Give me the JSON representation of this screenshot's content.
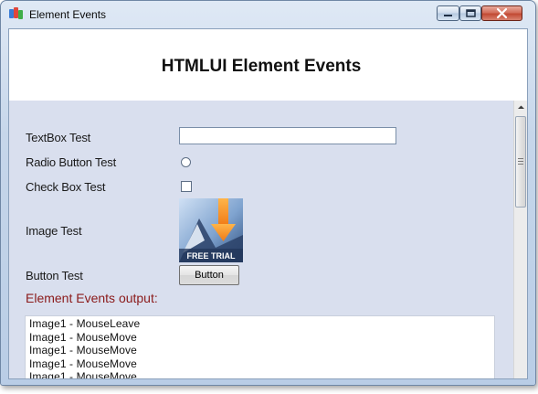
{
  "window": {
    "title": "Element Events",
    "accent": "#c24a34"
  },
  "page": {
    "title": "HTMLUI Element Events"
  },
  "form": {
    "textbox_label": "TextBox Test",
    "textbox_value": "",
    "radio_label": "Radio Button Test",
    "radio_checked": false,
    "checkbox_label": "Check Box Test",
    "checkbox_checked": false,
    "image_label": "Image Test",
    "image_caption": "FREE TRIAL",
    "button_label": "Button Test",
    "button_text": "Button"
  },
  "output": {
    "heading": "Element Events output:",
    "heading_color": "#8b1a1a",
    "lines": [
      "Image1 - MouseLeave",
      "Image1 - MouseMove",
      "Image1 - MouseMove",
      "Image1 - MouseMove",
      "Image1 - MouseMove"
    ]
  },
  "icons": {
    "app": "app-icon",
    "minimize": "minimize-icon",
    "maximize": "maximize-icon",
    "close": "close-icon",
    "scroll_up": "chevron-up-icon",
    "scroll_grip": "grip-icon"
  }
}
